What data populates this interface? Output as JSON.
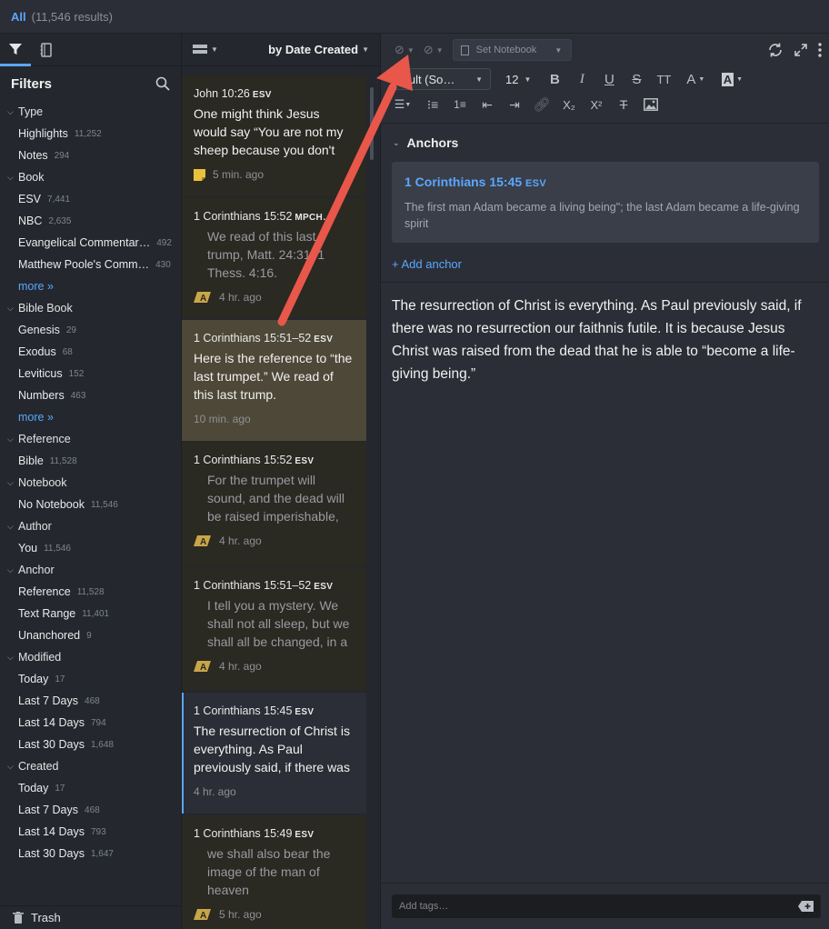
{
  "topbar": {
    "all_label": "All",
    "count_label": "(11,546 results)"
  },
  "sidebar": {
    "filters_title": "Filters",
    "rows": [
      {
        "kind": "section",
        "label": "Type"
      },
      {
        "kind": "item",
        "label": "Highlights",
        "count": "11,252"
      },
      {
        "kind": "item",
        "label": "Notes",
        "count": "294"
      },
      {
        "kind": "section",
        "label": "Book"
      },
      {
        "kind": "item",
        "label": "ESV",
        "count": "7,441"
      },
      {
        "kind": "item",
        "label": "NBC",
        "count": "2,635"
      },
      {
        "kind": "item",
        "label": "Evangelical Commentar…",
        "count": "492"
      },
      {
        "kind": "item",
        "label": "Matthew Poole's Comm…",
        "count": "430"
      },
      {
        "kind": "more",
        "label": "more »"
      },
      {
        "kind": "section",
        "label": "Bible Book"
      },
      {
        "kind": "item",
        "label": "Genesis",
        "count": "29"
      },
      {
        "kind": "item",
        "label": "Exodus",
        "count": "68"
      },
      {
        "kind": "item",
        "label": "Leviticus",
        "count": "152"
      },
      {
        "kind": "item",
        "label": "Numbers",
        "count": "463"
      },
      {
        "kind": "more",
        "label": "more »"
      },
      {
        "kind": "section",
        "label": "Reference"
      },
      {
        "kind": "item",
        "label": "Bible",
        "count": "11,528"
      },
      {
        "kind": "section",
        "label": "Notebook"
      },
      {
        "kind": "item",
        "label": "No Notebook",
        "count": "11,546"
      },
      {
        "kind": "section",
        "label": "Author"
      },
      {
        "kind": "item",
        "label": "You",
        "count": "11,546"
      },
      {
        "kind": "section",
        "label": "Anchor"
      },
      {
        "kind": "item",
        "label": "Reference",
        "count": "11,528"
      },
      {
        "kind": "item",
        "label": "Text Range",
        "count": "11,401"
      },
      {
        "kind": "item",
        "label": "Unanchored",
        "count": "9"
      },
      {
        "kind": "section",
        "label": "Modified"
      },
      {
        "kind": "item",
        "label": "Today",
        "count": "17"
      },
      {
        "kind": "item",
        "label": "Last 7 Days",
        "count": "468"
      },
      {
        "kind": "item",
        "label": "Last 14 Days",
        "count": "794"
      },
      {
        "kind": "item",
        "label": "Last 30 Days",
        "count": "1,648"
      },
      {
        "kind": "section",
        "label": "Created"
      },
      {
        "kind": "item",
        "label": "Today",
        "count": "17"
      },
      {
        "kind": "item",
        "label": "Last 7 Days",
        "count": "468"
      },
      {
        "kind": "item",
        "label": "Last 14 Days",
        "count": "793"
      },
      {
        "kind": "item",
        "label": "Last 30 Days",
        "count": "1,647"
      }
    ],
    "trash_label": "Trash"
  },
  "list": {
    "sort_label": "by Date Created",
    "cards": [
      {
        "ref": "John 10:26",
        "version": "ESV",
        "title": "One might think Jesus would say “You are not my sheep because you don't",
        "excerpt": "",
        "time": "5 min. ago",
        "badge": "note",
        "state": "normal"
      },
      {
        "ref": "1 Corinthians 15:52",
        "version": "MPCH…",
        "title": "",
        "excerpt": "We read of this last trump, Matt. 24:31; 1 Thess. 4:16.",
        "time": "4 hr. ago",
        "badge": "highlight",
        "state": "normal"
      },
      {
        "ref": "1 Corinthians 15:51–52",
        "version": "ESV",
        "title": "Here is the reference to “the last trumpet.” We read of this last trump.",
        "excerpt": "",
        "time": "10 min. ago",
        "badge": "",
        "state": "selected"
      },
      {
        "ref": "1 Corinthians 15:52",
        "version": "ESV",
        "title": "",
        "excerpt": "For the trumpet will sound, and the dead will be raised imperishable,",
        "time": "4 hr. ago",
        "badge": "highlight",
        "state": "normal"
      },
      {
        "ref": "1 Corinthians 15:51–52",
        "version": "ESV",
        "title": "",
        "excerpt": "I tell you a mystery. We shall not all sleep, but we shall all be changed, in a",
        "time": "4 hr. ago",
        "badge": "highlight",
        "state": "normal"
      },
      {
        "ref": "1 Corinthians 15:45",
        "version": "ESV",
        "title": "The resurrection of Christ is everything. As Paul previously said, if there was",
        "excerpt": "",
        "time": "4 hr. ago",
        "badge": "",
        "state": "current"
      },
      {
        "ref": "1 Corinthians 15:49",
        "version": "ESV",
        "title": "",
        "excerpt": "we shall also bear the image of the man of heaven",
        "time": "5 hr. ago",
        "badge": "highlight",
        "state": "normal"
      }
    ]
  },
  "editor": {
    "notebook_label": "Set Notebook",
    "font_label": "fault (So…",
    "size_label": "12",
    "anchors_title": "Anchors",
    "anchor": {
      "ref": "1 Corinthians 15:45",
      "version": "ESV",
      "text": "The first man Adam became a living being\"; the last Adam became a life-giving spirit"
    },
    "add_anchor_label": "+ Add anchor",
    "body": "The resurrection of Christ is everything. As Paul previously said, if there was no resurrection our faithnis futile. It is because Jesus Christ was raised from the dead that he is able to “become a life-giving being.”",
    "tags_placeholder": "Add tags…"
  },
  "colors": {
    "accent": "#5aa7ff",
    "annotation_arrow": "#e8574a",
    "note_badge": "#e8c23a",
    "highlight_badge": "#c9a54a"
  }
}
